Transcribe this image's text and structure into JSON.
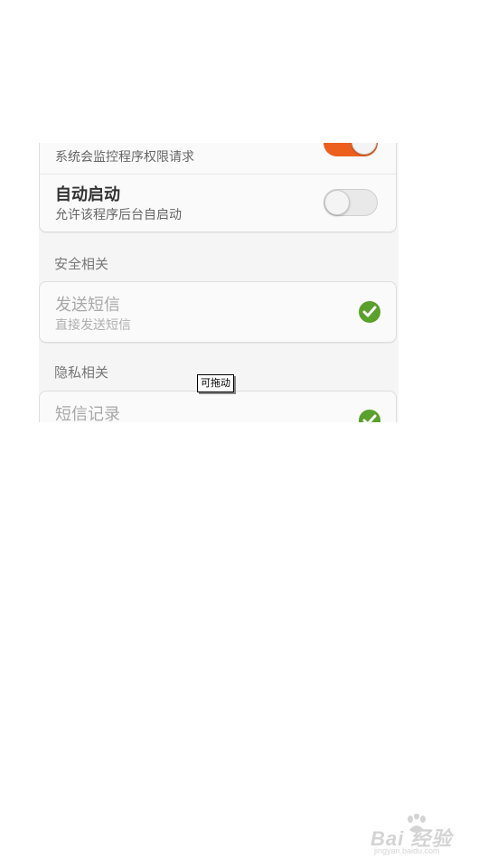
{
  "permissions_top": {
    "monitor_row": {
      "subtitle": "系统会监控程序权限请求",
      "toggle_state": "on"
    },
    "autostart_row": {
      "title": "自动启动",
      "subtitle": "允许该程序后台自启动",
      "toggle_state": "off"
    }
  },
  "security_section": {
    "header": "安全相关",
    "items": [
      {
        "title": "发送短信",
        "subtitle": "直接发送短信",
        "status": "check-icon"
      }
    ]
  },
  "privacy_section": {
    "header": "隐私相关",
    "items": [
      {
        "title": "短信记录",
        "status": "check-icon"
      }
    ]
  },
  "tooltip": {
    "text": "可拖动"
  },
  "watermark": {
    "brand": "Bai 经验",
    "url": "jingyan.baidu.com"
  },
  "colors": {
    "toggle_on": "#ec5f1f",
    "check_green": "#5aa02c",
    "card_bg": "#fafafa"
  }
}
